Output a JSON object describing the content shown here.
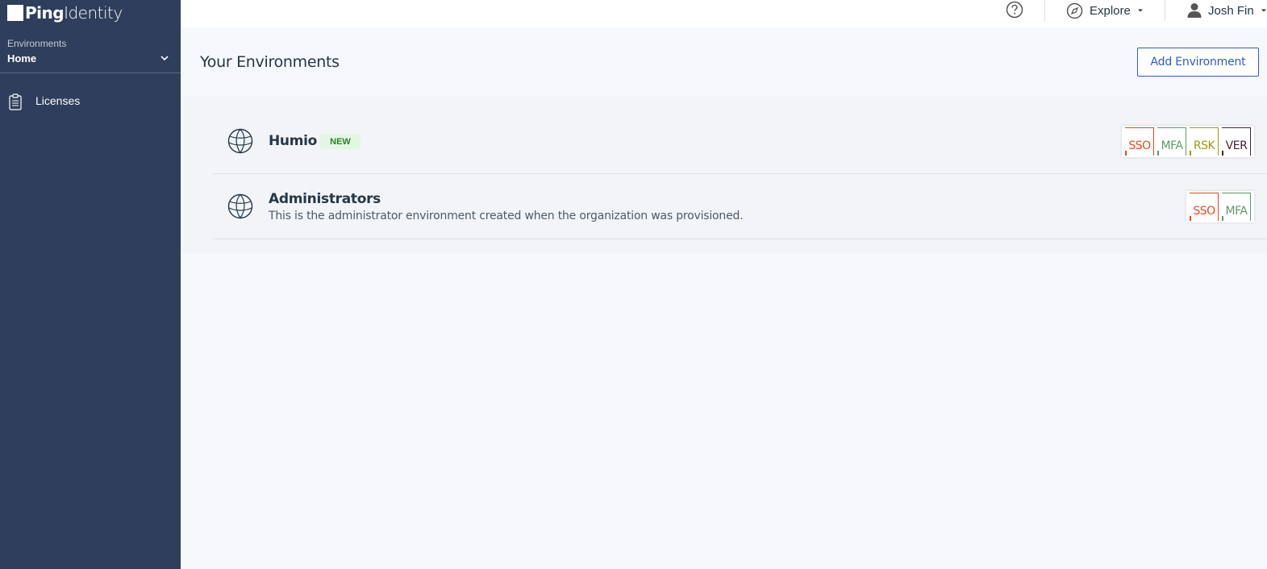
{
  "brand": {
    "logo_bold": "Ping",
    "logo_light": "Identity",
    "logo_mark": "."
  },
  "sidebar": {
    "env_label": "Environments",
    "env_value": "Home",
    "items": [
      {
        "label": "Licenses",
        "icon": "clipboard-icon"
      }
    ]
  },
  "topbar": {
    "help_icon": "help-circle-icon",
    "explore_label": "Explore",
    "explore_icon": "compass-icon",
    "user_label": "Josh Fin",
    "user_icon": "person-icon"
  },
  "main": {
    "title": "Your Environments",
    "add_button": "Add Environment",
    "environments": [
      {
        "name": "Humio",
        "badge": "NEW",
        "description": "",
        "services": [
          "SSO",
          "MFA",
          "RSK",
          "VER"
        ]
      },
      {
        "name": "Administrators",
        "badge": "",
        "description": "This is the administrator environment created when the organization was provisioned.",
        "services": [
          "SSO",
          "MFA"
        ]
      }
    ]
  },
  "colors": {
    "sidebar_bg": "#2e3e5c",
    "accent": "#2e58d6",
    "sso": "#e8471c",
    "mfa": "#5c9a6a",
    "rsk": "#9a9a12",
    "ver": "#4a1f3a",
    "new_badge": "#e3f6e3"
  }
}
